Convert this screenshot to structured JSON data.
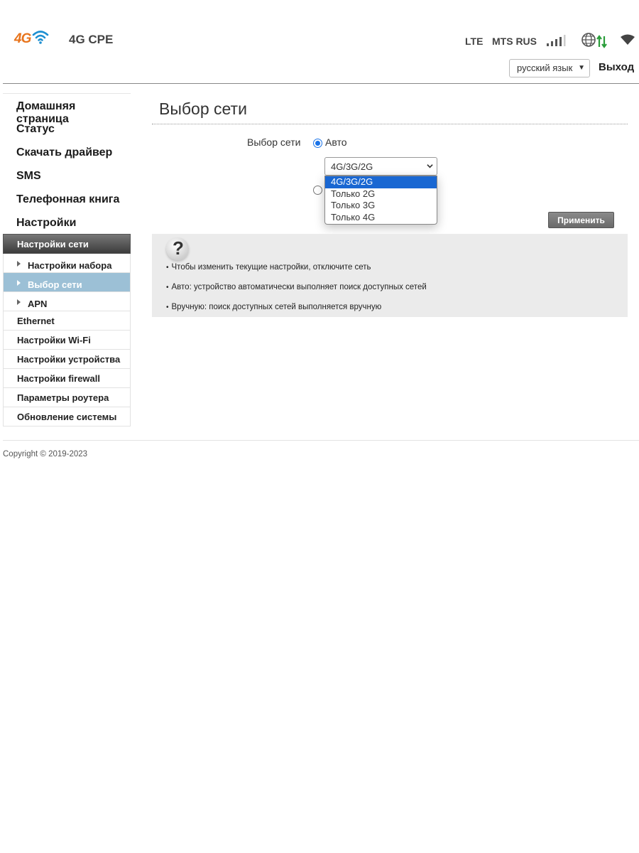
{
  "header": {
    "logo_badge": "4G",
    "product_title": "4G CPE",
    "network_type": "LTE",
    "operator": "MTS RUS",
    "signal_bars": 4,
    "language_selected": "русский язык",
    "logout_label": "Выход",
    "colors": {
      "logo_orange": "#e8741c",
      "logo_wifi_blue": "#1d8fd1",
      "data_green": "#2a9d3a"
    }
  },
  "sidebar": {
    "top_items": [
      {
        "label": "Домашняя страница"
      },
      {
        "label": "Статус"
      },
      {
        "label": "Скачать драйвер"
      },
      {
        "label": "SMS"
      },
      {
        "label": "Телефонная книга"
      },
      {
        "label": "Настройки"
      }
    ],
    "active_section": "Настройки сети",
    "sub_items": [
      {
        "label": "Настройки набора",
        "active": false
      },
      {
        "label": "Выбор сети",
        "active": true
      },
      {
        "label": "APN",
        "active": false
      }
    ],
    "other_items": [
      {
        "label": "Ethernet"
      },
      {
        "label": "Настройки Wi-Fi"
      },
      {
        "label": "Настройки устройства"
      },
      {
        "label": "Настройки firewall"
      },
      {
        "label": "Параметры роутера"
      },
      {
        "label": "Обновление системы"
      }
    ]
  },
  "main": {
    "title": "Выбор сети",
    "form_label": "Выбор сети",
    "auto_label": "Авто",
    "mode_selected": "4G/3G/2G",
    "mode_options": [
      "4G/3G/2G",
      "Только 2G",
      "Только 3G",
      "Только 4G"
    ],
    "apply_label": "Применить",
    "help_icon_glyph": "?",
    "help_lines": [
      "Чтобы изменить текущие настройки, отключите сеть",
      "Авто: устройство автоматически выполняет поиск доступных сетей",
      "Вручную: поиск доступных сетей выполняется вручную"
    ]
  },
  "footer": {
    "copyright": "Copyright © 2019-2023"
  }
}
